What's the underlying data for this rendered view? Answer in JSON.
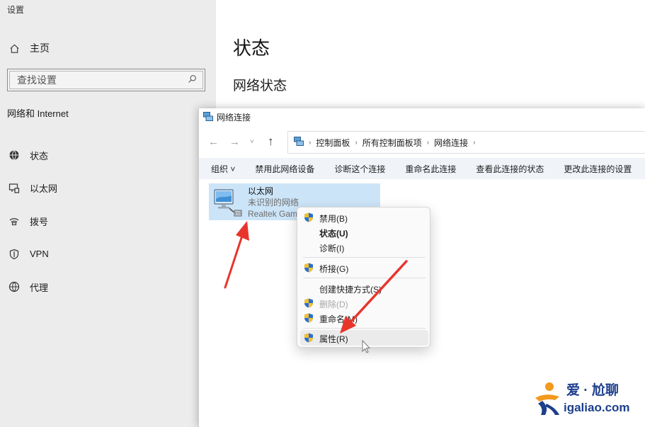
{
  "settings": {
    "app_title": "设置",
    "home_label": "主页",
    "search_placeholder": "查找设置",
    "section_title": "网络和 Internet",
    "nav_items": [
      {
        "label": "状态",
        "icon": "globe-icon"
      },
      {
        "label": "以太网",
        "icon": "ethernet-icon"
      },
      {
        "label": "拨号",
        "icon": "dialup-icon"
      },
      {
        "label": "VPN",
        "icon": "vpn-icon"
      },
      {
        "label": "代理",
        "icon": "proxy-globe-icon"
      }
    ],
    "main_title": "状态",
    "main_subtitle": "网络状态"
  },
  "explorer": {
    "window_title": "网络连接",
    "breadcrumb": [
      "控制面板",
      "所有控制面板项",
      "网络连接"
    ],
    "toolbar": [
      "组织 ˅",
      "禁用此网络设备",
      "诊断这个连接",
      "重命名此连接",
      "查看此连接的状态",
      "更改此连接的设置"
    ],
    "adapter": {
      "name": "以太网",
      "status": "未识别的网络",
      "device": "Realtek Gam"
    }
  },
  "context_menu": {
    "items": [
      {
        "label": "禁用(B)",
        "shield": true
      },
      {
        "label": "状态(U)",
        "shield": false,
        "bold": true
      },
      {
        "label": "诊断(I)",
        "shield": false
      },
      {
        "label": "桥接(G)",
        "shield": true
      },
      {
        "label": "创建快捷方式(S)",
        "shield": false
      },
      {
        "label": "删除(D)",
        "shield": true,
        "disabled": true
      },
      {
        "label": "重命名(M)",
        "shield": true
      },
      {
        "label": "属性(R)",
        "shield": true,
        "highlighted": true
      }
    ]
  },
  "watermark": {
    "top": "爱 · 尬聊",
    "bottom": "igaliao.com"
  },
  "colors": {
    "sidebar_bg": "#ececec",
    "toolbar_bg": "#f0f4f9",
    "selection_bg": "#cce4f7",
    "arrow_red": "#e8352c",
    "watermark_blue": "#1d3f8c"
  }
}
